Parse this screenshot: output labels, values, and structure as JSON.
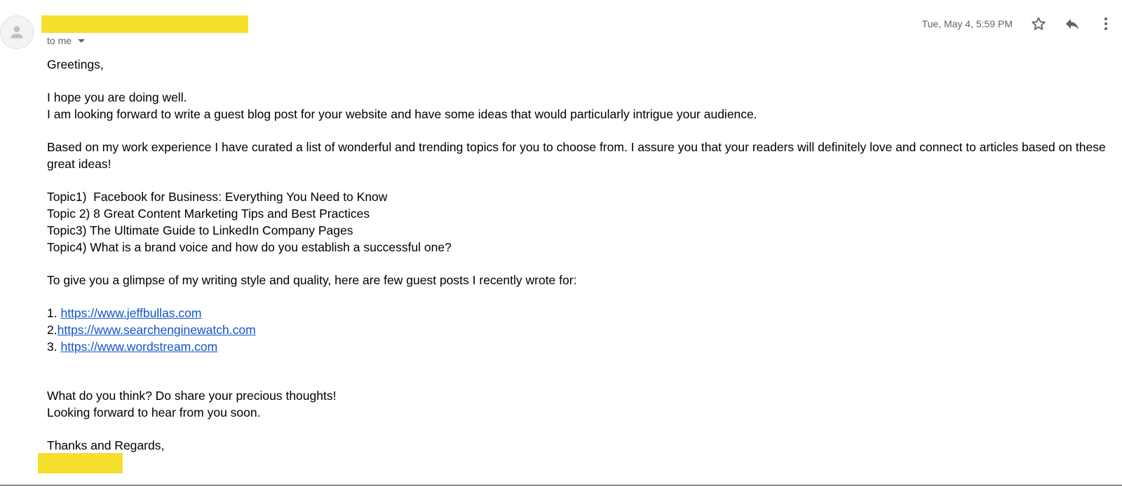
{
  "header": {
    "recipient_label": "to me",
    "date": "Tue, May 4, 5:59 PM",
    "icons": {
      "avatar": "person-icon",
      "star": "star-icon",
      "reply": "reply-icon",
      "more": "more-vert-icon",
      "recipient_dropdown": "caret-down-icon"
    }
  },
  "message": {
    "greeting": "Greetings,",
    "para1_line1": "I hope you are doing well.",
    "para1_line2": "I am looking forward to write a guest blog post for your website and have some ideas that would particularly intrigue your audience.",
    "para2": "Based on my work experience I have curated a list of wonderful and trending topics for you to choose from. I assure you that your readers will definitely love and connect to articles based on these great ideas!",
    "topics": [
      "Topic1)  Facebook for Business: Everything You Need to Know",
      "Topic 2) 8 Great Content Marketing Tips and Best Practices",
      "Topic3) The Ultimate Guide to LinkedIn Company Pages",
      "Topic4) What is a brand voice and how do you establish a successful one?"
    ],
    "para3": "To give you a glimpse of my writing style and quality, here are few guest posts I recently wrote for:",
    "links": [
      {
        "prefix": "1. ",
        "url": "https://www.jeffbullas.com"
      },
      {
        "prefix": "2.",
        "url": "https://www.searchenginewatch.com"
      },
      {
        "prefix": "3. ",
        "url": "https://www.wordstream.com"
      }
    ],
    "closing_line1": "What do you think? Do share your precious thoughts!",
    "closing_line2": "Looking forward to hear from you soon.",
    "signoff": "Thanks and Regards,"
  },
  "colors": {
    "redaction": "#f4df2c",
    "link": "#1155cc",
    "muted": "#5f6368"
  }
}
